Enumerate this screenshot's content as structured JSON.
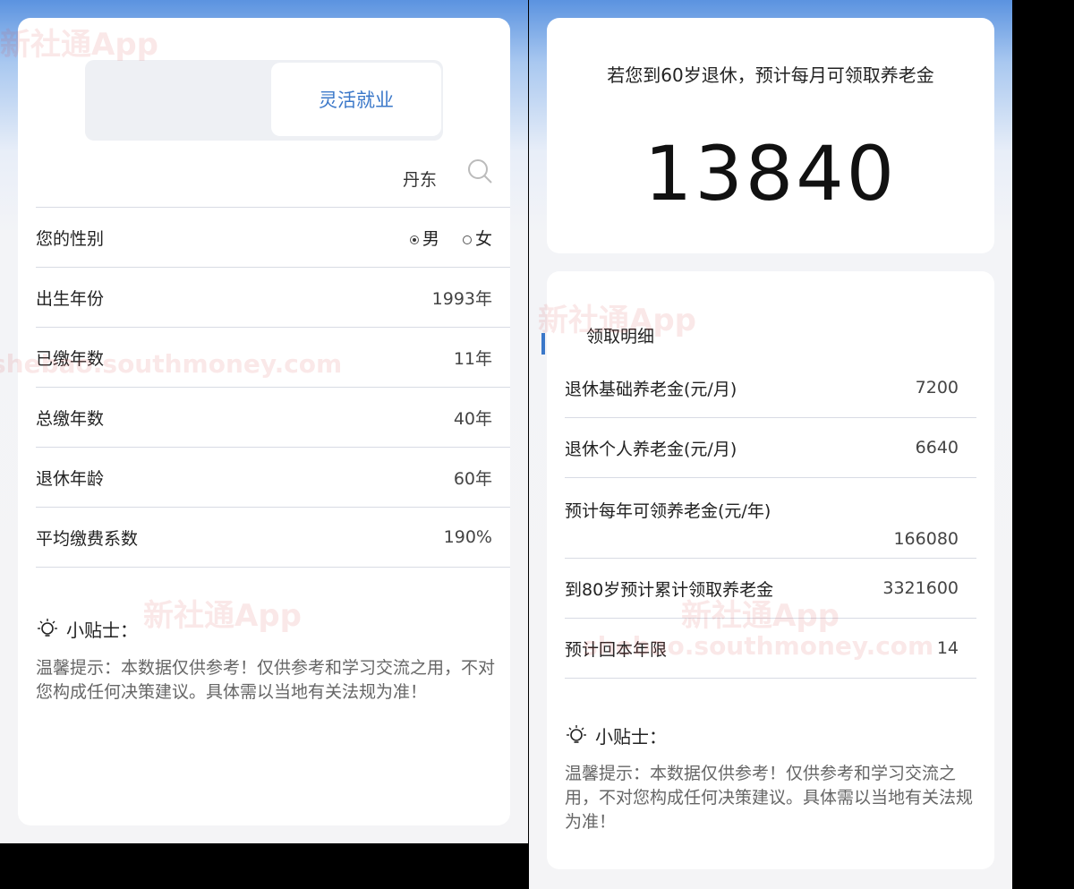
{
  "left": {
    "tabs": [
      {
        "label": "灵活就业"
      }
    ],
    "city": "丹东",
    "gender": {
      "label": "您的性别",
      "options": [
        "男",
        "女"
      ],
      "selected": "男"
    },
    "rows": [
      {
        "label": "出生年份",
        "value": "1993年"
      },
      {
        "label": "已缴年数",
        "value": "11年"
      },
      {
        "label": "总缴年数",
        "value": "40年"
      },
      {
        "label": "退休年龄",
        "value": "60年"
      },
      {
        "label": "平均缴费系数",
        "value": "190%"
      }
    ],
    "tip": {
      "title": "小贴士：",
      "text": "温馨提示：本数据仅供参考！仅供参考和学习交流之用，不对您构成任何决策建议。具体需以当地有关法规为准！"
    }
  },
  "right": {
    "headline": "若您到60岁退休，预计每月可领取养老金",
    "monthly_amount": "13840",
    "detail_title": "领取明细",
    "details": [
      {
        "label": "退休基础养老金(元/月)",
        "value": "7200"
      },
      {
        "label": "退休个人养老金(元/月)",
        "value": "6640"
      },
      {
        "label": "预计每年可领养老金(元/年)",
        "value": "166080"
      },
      {
        "label": "到80岁预计累计领取养老金",
        "value": "3321600"
      },
      {
        "label": "预计回本年限",
        "value": "14"
      }
    ],
    "tip": {
      "title": "小贴士：",
      "text": "温馨提示：本数据仅供参考！仅供参考和学习交流之用，不对您构成任何决策建议。具体需以当地有关法规为准！"
    }
  },
  "watermark": {
    "text": "新社通App",
    "url": "shebao.southmoney.com"
  },
  "colors": {
    "accent": "#3b78c9",
    "background": "#f4f4f6"
  }
}
